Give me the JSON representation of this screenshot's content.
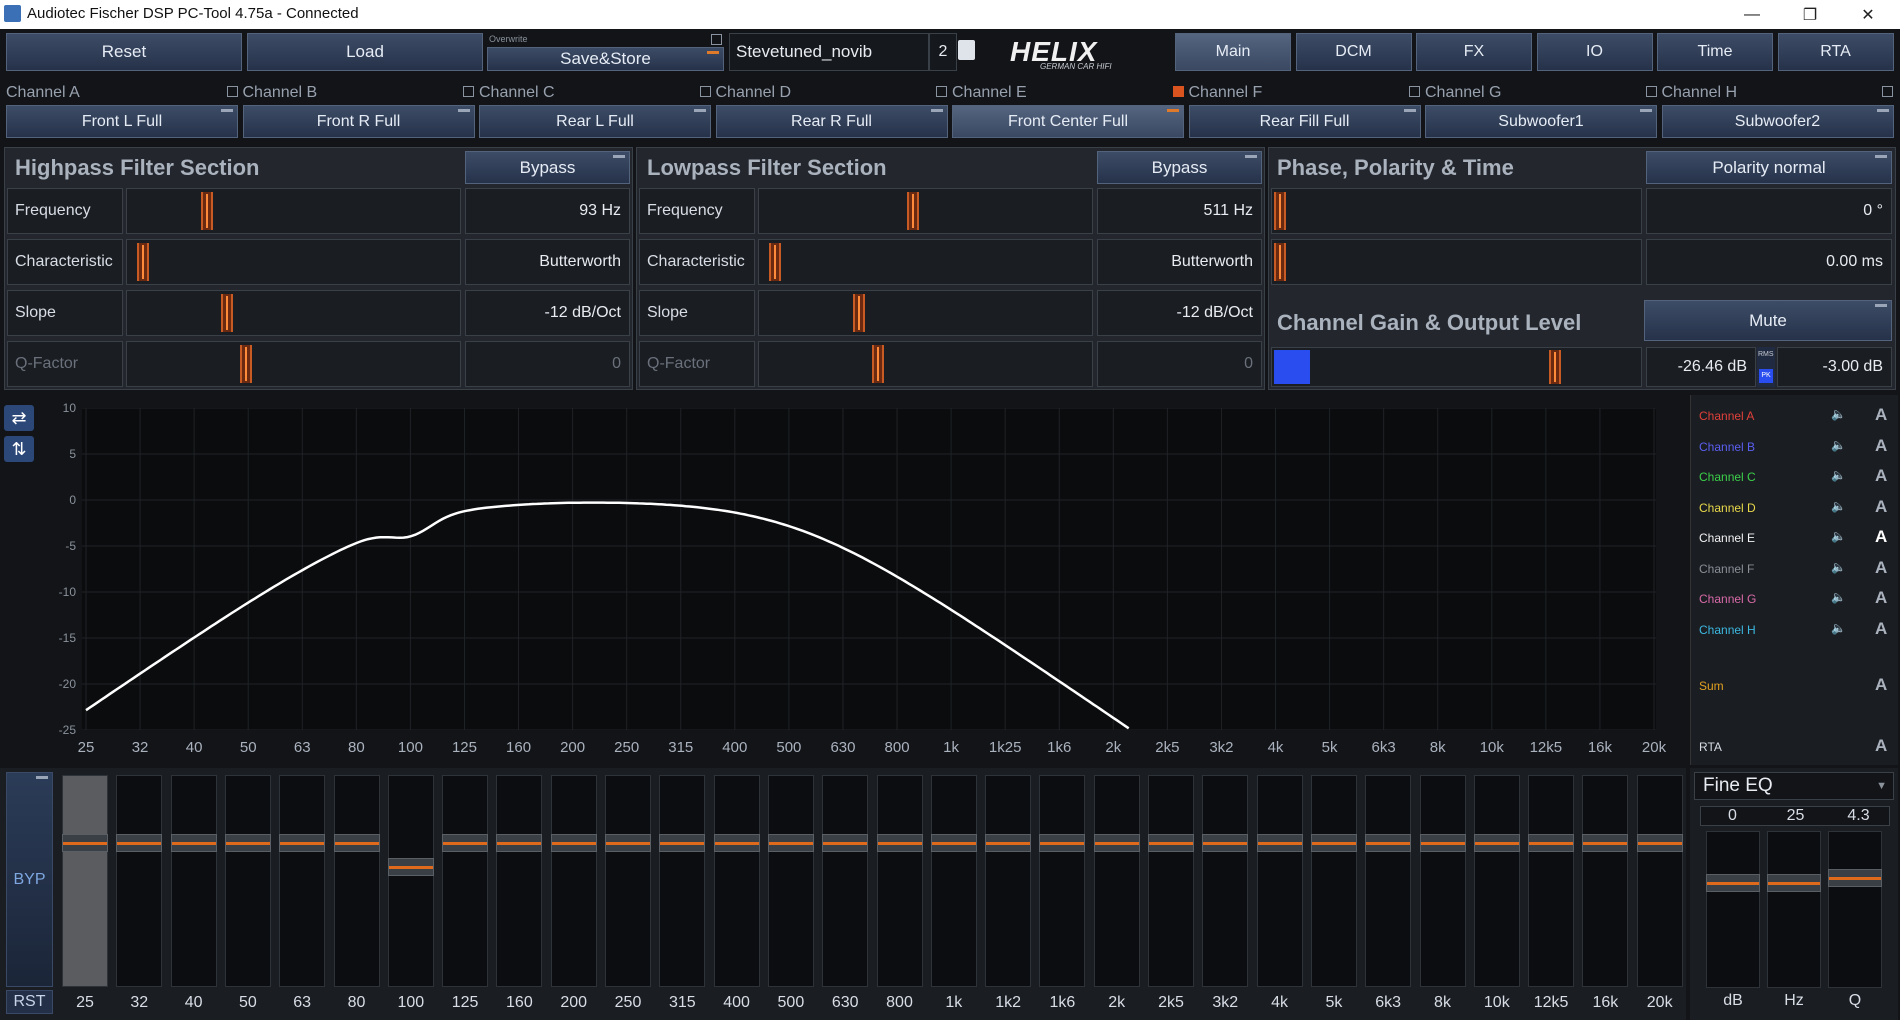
{
  "window": {
    "title": "Audiotec Fischer DSP PC-Tool 4.75a - Connected",
    "minimize": "—",
    "restore": "❐",
    "close": "✕"
  },
  "toolbar": {
    "reset": "Reset",
    "load": "Load",
    "overwrite_hint": "Overwrite",
    "save_store": "Save&Store",
    "preset_name": "Stevetuned_novib",
    "preset_slot": "2",
    "logo_text": "HELIX",
    "logo_sub": "GERMAN CAR HIFI"
  },
  "tabs": [
    "Main",
    "DCM",
    "FX",
    "IO",
    "Time",
    "RTA"
  ],
  "channels": [
    {
      "label": "Channel A",
      "name": "Front L Full"
    },
    {
      "label": "Channel B",
      "name": "Front R Full"
    },
    {
      "label": "Channel C",
      "name": "Rear L Full"
    },
    {
      "label": "Channel D",
      "name": "Rear R Full"
    },
    {
      "label": "Channel E",
      "name": "Front Center Full"
    },
    {
      "label": "Channel F",
      "name": "Rear Fill Full"
    },
    {
      "label": "Channel G",
      "name": "Subwoofer1"
    },
    {
      "label": "Channel H",
      "name": "Subwoofer2"
    }
  ],
  "highpass": {
    "title": "Highpass Filter Section",
    "bypass": "Bypass",
    "rows": [
      {
        "label": "Frequency",
        "value": "93 Hz",
        "pos": 0.22
      },
      {
        "label": "Characteristic",
        "value": "Butterworth",
        "pos": 0.02
      },
      {
        "label": "Slope",
        "value": "-12 dB/Oct",
        "pos": 0.28
      },
      {
        "label": "Q-Factor",
        "value": "0",
        "pos": 0.34
      }
    ]
  },
  "lowpass": {
    "title": "Lowpass Filter Section",
    "bypass": "Bypass",
    "rows": [
      {
        "label": "Frequency",
        "value": "511 Hz",
        "pos": 0.45
      },
      {
        "label": "Characteristic",
        "value": "Butterworth",
        "pos": 0.02
      },
      {
        "label": "Slope",
        "value": "-12 dB/Oct",
        "pos": 0.28
      },
      {
        "label": "Q-Factor",
        "value": "0",
        "pos": 0.34
      }
    ]
  },
  "phase": {
    "title": "Phase, Polarity & Time",
    "polarity": "Polarity normal",
    "phase_value": "0 °",
    "time_value": "0.00 ms"
  },
  "gain": {
    "title": "Channel Gain & Output Level",
    "mute": "Mute",
    "level": "-26.46 dB",
    "gain": "-3.00 dB",
    "rms": "RMS",
    "pk": "PK"
  },
  "graph": {
    "y_ticks": [
      "10",
      "5",
      "0",
      "-5",
      "-10",
      "-15",
      "-20",
      "-25"
    ],
    "x_ticks": [
      "25",
      "32",
      "40",
      "50",
      "63",
      "80",
      "100",
      "125",
      "160",
      "200",
      "250",
      "315",
      "400",
      "500",
      "630",
      "800",
      "1k",
      "1k25",
      "1k6",
      "2k",
      "2k5",
      "3k2",
      "4k",
      "5k",
      "6k3",
      "8k",
      "10k",
      "12k5",
      "16k",
      "20k"
    ]
  },
  "legend": [
    {
      "name": "Channel A",
      "color": "#e0403a"
    },
    {
      "name": "Channel B",
      "color": "#5b5ff0"
    },
    {
      "name": "Channel C",
      "color": "#3ccf4a"
    },
    {
      "name": "Channel D",
      "color": "#e8d84a"
    },
    {
      "name": "Channel E",
      "color": "#f2f2f2"
    },
    {
      "name": "Channel F",
      "color": "#8a8f96"
    },
    {
      "name": "Channel G",
      "color": "#d86aa8"
    },
    {
      "name": "Channel H",
      "color": "#3cb8e0"
    }
  ],
  "legend_extra": {
    "sum": "Sum",
    "sum_color": "#e0a020",
    "rta": "RTA",
    "a": "A"
  },
  "eq": {
    "byp": "BYP",
    "rst": "RST",
    "bands": [
      "25",
      "32",
      "40",
      "50",
      "63",
      "80",
      "100",
      "125",
      "160",
      "200",
      "250",
      "315",
      "400",
      "500",
      "630",
      "800",
      "1k",
      "1k2",
      "1k6",
      "2k",
      "2k5",
      "3k2",
      "4k",
      "5k",
      "6k3",
      "8k",
      "10k",
      "12k5",
      "16k",
      "20k"
    ],
    "levels": [
      0,
      0,
      0,
      0,
      0,
      0,
      -1.5,
      0,
      0,
      0,
      0,
      0,
      0,
      0,
      0,
      0,
      0,
      0,
      0,
      0,
      0,
      0,
      0,
      0,
      0,
      0,
      0,
      0,
      0,
      0
    ]
  },
  "fine_eq": {
    "title": "Fine EQ",
    "db": "0",
    "hz": "25",
    "q": "4.3",
    "db_label": "dB",
    "hz_label": "Hz",
    "q_label": "Q"
  }
}
